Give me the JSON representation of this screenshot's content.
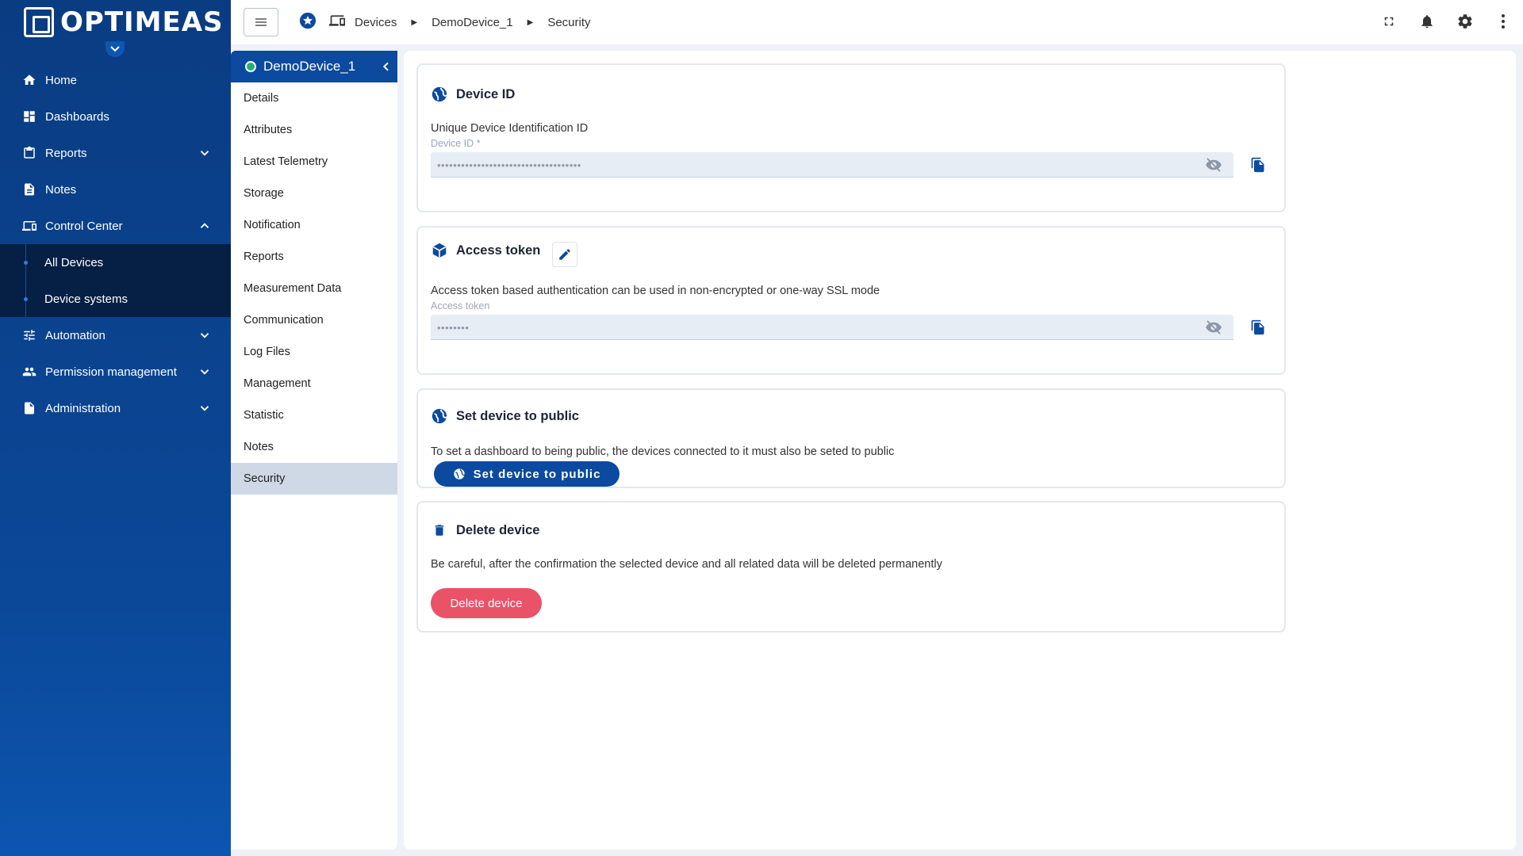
{
  "brand": {
    "logo_text": "OPTIMEAS"
  },
  "nav": {
    "items": [
      {
        "label": "Home",
        "icon": "home-icon"
      },
      {
        "label": "Dashboards",
        "icon": "dashboard-icon"
      },
      {
        "label": "Reports",
        "icon": "clipboard-icon",
        "expandable": true
      },
      {
        "label": "Notes",
        "icon": "note-icon"
      },
      {
        "label": "Control Center",
        "icon": "devices-icon",
        "expanded": true
      },
      {
        "label": "Automation",
        "icon": "sliders-icon",
        "expandable": true
      },
      {
        "label": "Permission management",
        "icon": "people-icon",
        "expandable": true
      },
      {
        "label": "Administration",
        "icon": "admin-icon",
        "expandable": true
      }
    ],
    "control_center_children": [
      {
        "label": "All Devices"
      },
      {
        "label": "Device systems"
      }
    ]
  },
  "breadcrumb": [
    "Devices",
    "DemoDevice_1",
    "Security"
  ],
  "device_menu": {
    "title": "DemoDevice_1",
    "items": [
      "Details",
      "Attributes",
      "Latest Telemetry",
      "Storage",
      "Notification",
      "Reports",
      "Measurement Data",
      "Communication",
      "Log Files",
      "Management",
      "Statistic",
      "Notes",
      "Security"
    ],
    "active": "Security"
  },
  "cards": {
    "device_id": {
      "title": "Device ID",
      "description": "Unique Device Identification ID",
      "field_label": "Device ID *",
      "masked_value": "••••••••••••••••••••••••••••••••••••"
    },
    "access_token": {
      "title": "Access token",
      "description": "Access token based authentication can be used in non-encrypted or one-way SSL mode",
      "field_label": "Access token",
      "masked_value": "••••••••"
    },
    "public": {
      "title": "Set device to public",
      "description": "To set a dashboard to being public, the devices connected to it must also be seted to public",
      "button": "Set device to public"
    },
    "delete": {
      "title": "Delete device",
      "description": "Be careful, after the confirmation the selected device and all related data will be deleted permanently",
      "button": "Delete device"
    }
  },
  "colors": {
    "nav_bg": "#0b4898",
    "accent": "#0b4a9e",
    "danger": "#ea5268",
    "status_online": "#22b07a"
  }
}
